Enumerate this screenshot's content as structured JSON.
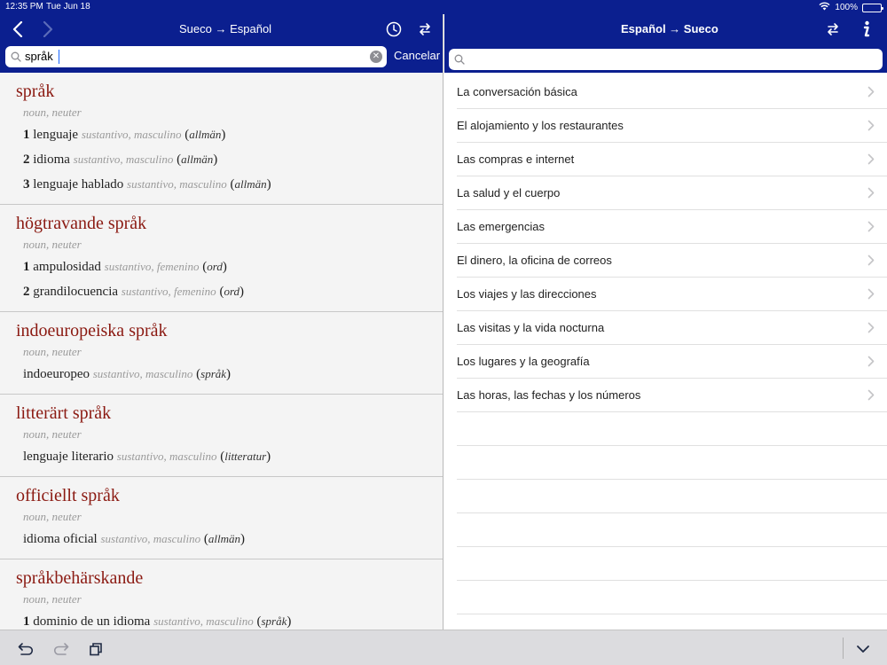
{
  "status_bar": {
    "time": "12:35 PM",
    "date": "Tue Jun 18",
    "battery": "100%",
    "icons": [
      "wifi-icon",
      "battery-icon"
    ]
  },
  "left_pane": {
    "title": "Sueco → Español",
    "search_value": "språk",
    "cancel_label": "Cancelar",
    "icons": [
      "back-icon",
      "forward-icon",
      "history-icon",
      "swap-icon",
      "search-icon",
      "clear-icon"
    ],
    "entries": [
      {
        "headword": "språk",
        "pos": "noun, neuter",
        "senses": [
          {
            "num": "1",
            "translation": "lenguaje",
            "gram": "sustantivo, masculino",
            "ctx": "allmän"
          },
          {
            "num": "2",
            "translation": "idioma",
            "gram": "sustantivo, masculino",
            "ctx": "allmän"
          },
          {
            "num": "3",
            "translation": "lenguaje hablado",
            "gram": "sustantivo, masculino",
            "ctx": "allmän"
          }
        ]
      },
      {
        "headword": "högtravande språk",
        "pos": "noun, neuter",
        "senses": [
          {
            "num": "1",
            "translation": "ampulosidad",
            "gram": "sustantivo, femenino",
            "ctx": "ord"
          },
          {
            "num": "2",
            "translation": "grandilocuencia",
            "gram": "sustantivo, femenino",
            "ctx": "ord"
          }
        ]
      },
      {
        "headword": "indoeuropeiska språk",
        "pos": "noun, neuter",
        "senses": [
          {
            "num": "",
            "translation": "indoeuropeo",
            "gram": "sustantivo, masculino",
            "ctx": "språk"
          }
        ]
      },
      {
        "headword": "litterärt språk",
        "pos": "noun, neuter",
        "senses": [
          {
            "num": "",
            "translation": "lenguaje literario",
            "gram": "sustantivo, masculino",
            "ctx": "litteratur"
          }
        ]
      },
      {
        "headword": "officiellt språk",
        "pos": "noun, neuter",
        "senses": [
          {
            "num": "",
            "translation": "idioma oficial",
            "gram": "sustantivo, masculino",
            "ctx": "allmän"
          }
        ]
      },
      {
        "headword": "språkbehärskande",
        "pos": "noun, neuter",
        "senses": [
          {
            "num": "1",
            "translation": "dominio de un idioma",
            "gram": "sustantivo, masculino",
            "ctx": "språk"
          }
        ]
      }
    ]
  },
  "right_pane": {
    "title": "Español → Sueco",
    "search_placeholder": "",
    "icons": [
      "swap-icon",
      "info-icon",
      "search-icon",
      "chevron-right-icon"
    ],
    "topics": [
      "La conversación básica",
      "El alojamiento y los restaurantes",
      "Las compras e internet",
      "La salud y el cuerpo",
      "Las emergencias",
      "El dinero, la oficina de correos",
      "Los viajes y las direcciones",
      "Las visitas y la vida nocturna",
      "Los lugares y la geografía",
      "Las horas, las fechas y los números"
    ]
  },
  "toolbar": {
    "icons": [
      "undo-icon",
      "redo-icon",
      "copy-icon",
      "chevron-down-icon"
    ]
  },
  "colors": {
    "nav_blue": "#0b1f8f",
    "headword_red": "#8b1a12",
    "grammar_gray": "#9a9a9a"
  }
}
